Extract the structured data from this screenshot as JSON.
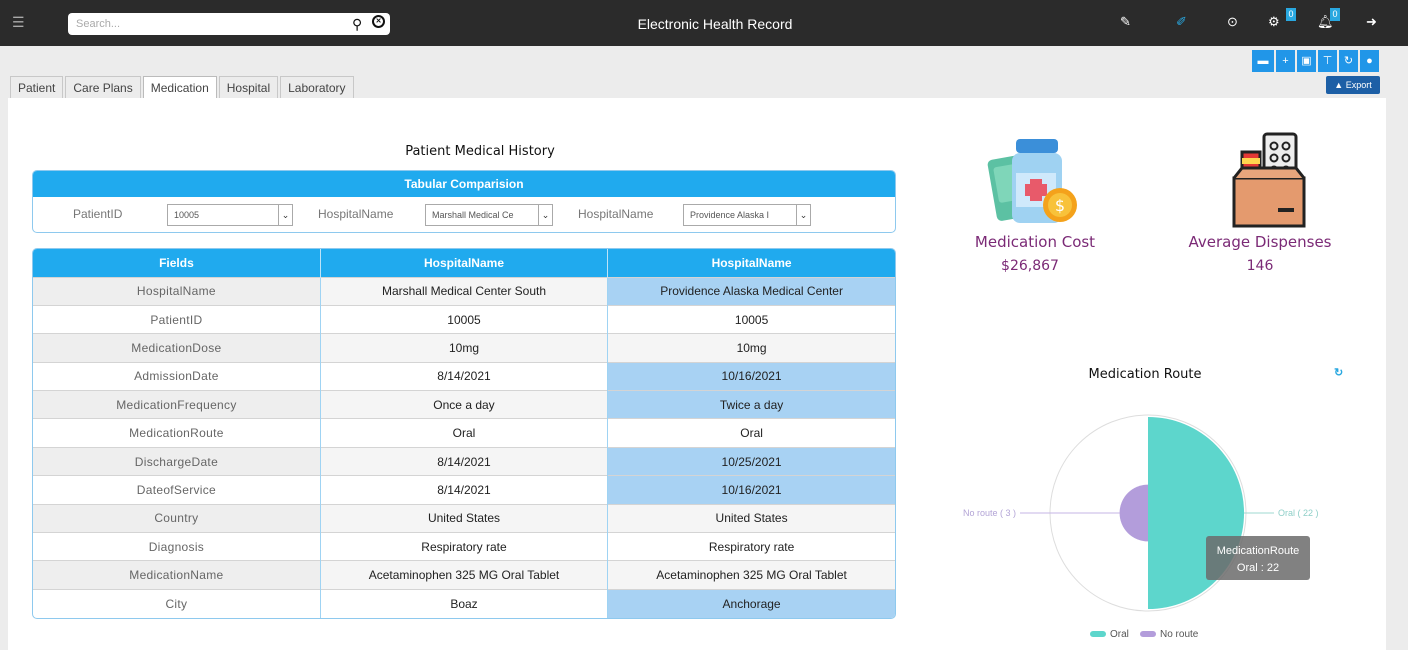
{
  "header": {
    "app_title": "Electronic Health Record",
    "search_placeholder": "Search...",
    "hamburger_icon": "menu-icon",
    "icons": [
      "wrench-icon",
      "edit-icon",
      "help-icon",
      "settings-icon",
      "bell-icon",
      "logout-icon"
    ],
    "settings_badge": "0",
    "notification_badge": "0"
  },
  "toolbar": {
    "buttons": [
      "folder-icon",
      "add-icon",
      "save-icon",
      "filter-icon",
      "refresh-icon",
      "user-icon"
    ],
    "export_label": "Export"
  },
  "tabs": [
    {
      "label": "Patient",
      "active": false
    },
    {
      "label": "Care Plans",
      "active": false
    },
    {
      "label": "Medication",
      "active": true
    },
    {
      "label": "Hospital",
      "active": false
    },
    {
      "label": "Laboratory",
      "active": false
    }
  ],
  "history": {
    "title": "Patient Medical History",
    "comparison_title": "Tabular Comparision",
    "patient_id_label": "PatientID",
    "patient_id_value": "10005",
    "hospital1_label": "HospitalName",
    "hospital1_value": "Marshall Medical Ce",
    "hospital2_label": "HospitalName",
    "hospital2_value": "Providence Alaska I"
  },
  "table": {
    "headers": [
      "Fields",
      "HospitalName",
      "HospitalName"
    ],
    "rows": [
      {
        "field": "HospitalName",
        "h1": "Marshall Medical Center South",
        "h2": "Providence Alaska Medical Center",
        "diff": true
      },
      {
        "field": "PatientID",
        "h1": "10005",
        "h2": "10005",
        "diff": false
      },
      {
        "field": "MedicationDose",
        "h1": "10mg",
        "h2": "10mg",
        "diff": false
      },
      {
        "field": "AdmissionDate",
        "h1": "8/14/2021",
        "h2": "10/16/2021",
        "diff": true
      },
      {
        "field": "MedicationFrequency",
        "h1": "Once a day",
        "h2": "Twice a day",
        "diff": true
      },
      {
        "field": "MedicationRoute",
        "h1": "Oral",
        "h2": "Oral",
        "diff": false
      },
      {
        "field": "DischargeDate",
        "h1": "8/14/2021",
        "h2": "10/25/2021",
        "diff": true
      },
      {
        "field": "DateofService",
        "h1": "8/14/2021",
        "h2": "10/16/2021",
        "diff": true
      },
      {
        "field": "Country",
        "h1": "United States",
        "h2": "United States",
        "diff": false
      },
      {
        "field": "Diagnosis",
        "h1": "Respiratory rate",
        "h2": "Respiratory rate",
        "diff": false
      },
      {
        "field": "MedicationName",
        "h1": "Acetaminophen 325 MG Oral Tablet",
        "h2": "Acetaminophen 325 MG Oral Tablet",
        "diff": false
      },
      {
        "field": "City",
        "h1": "Boaz",
        "h2": "Anchorage",
        "diff": true
      }
    ]
  },
  "stats": {
    "cost_label": "Medication Cost",
    "cost_value": "$26,867",
    "cost_icon": "medicine-bottle-icon",
    "dispenses_label": "Average Dispenses",
    "dispenses_value": "146",
    "dispenses_icon": "medicine-box-icon"
  },
  "colors": {
    "accent": "#20aaee",
    "topbar": "#2b2b2b",
    "diff_cell": "#a8d2f3",
    "stat_text": "#7b2a76",
    "oral": "#5dd6cc",
    "no_route": "#b39ddb"
  },
  "chart_data": {
    "type": "pie",
    "title": "Medication Route",
    "categories": [
      "Oral",
      "No route"
    ],
    "values": [
      22,
      3
    ],
    "labels": [
      "Oral ( 22 )",
      "No route ( 3 )"
    ],
    "legend": [
      "Oral",
      "No route"
    ],
    "legend_position": "bottom",
    "tooltip_title": "MedicationRoute",
    "tooltip_value": "Oral : 22"
  }
}
